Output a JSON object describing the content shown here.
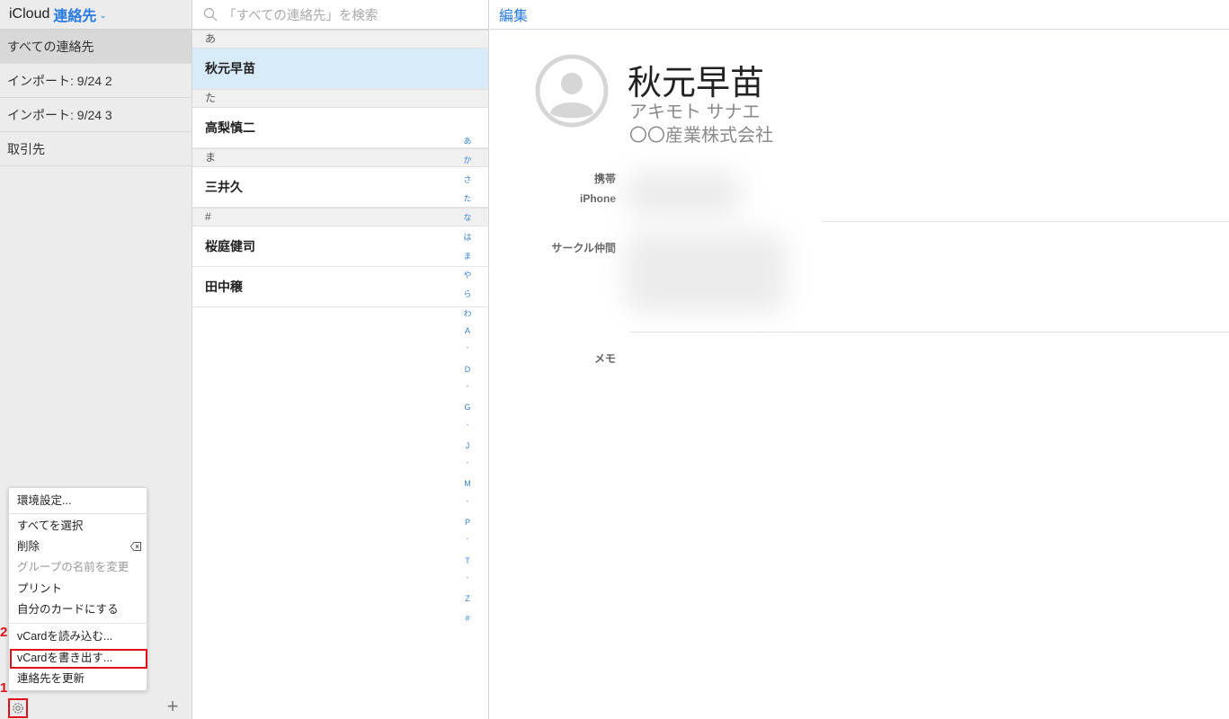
{
  "header": {
    "app_name": "iCloud",
    "section": "連絡先",
    "edit_label": "編集"
  },
  "sidebar": {
    "groups": [
      {
        "label": "すべての連絡先"
      },
      {
        "label": "インポート: 9/24 2"
      },
      {
        "label": "インポート: 9/24 3"
      },
      {
        "label": "取引先"
      }
    ],
    "add_symbol": "+"
  },
  "annotations": {
    "step1": "1",
    "step2": "2"
  },
  "menu": {
    "items": [
      {
        "label": "環境設定..."
      },
      {
        "label": "すべてを選択"
      },
      {
        "label": "削除"
      },
      {
        "label": "グループの名前を変更"
      },
      {
        "label": "プリント"
      },
      {
        "label": "自分のカードにする"
      },
      {
        "label": "vCardを読み込む..."
      },
      {
        "label": "vCardを書き出す..."
      },
      {
        "label": "連絡先を更新"
      }
    ]
  },
  "search": {
    "placeholder": "「すべての連絡先」を検索"
  },
  "contacts": {
    "sections": [
      {
        "header": "あ",
        "names": [
          "秋元早苗"
        ]
      },
      {
        "header": "た",
        "names": [
          "高梨慎二"
        ]
      },
      {
        "header": "ま",
        "names": [
          "三井久"
        ]
      },
      {
        "header": "#",
        "names": [
          "桜庭健司",
          "田中穣"
        ]
      }
    ],
    "index": [
      "あ",
      "か",
      "さ",
      "た",
      "な",
      "は",
      "ま",
      "や",
      "ら",
      "わ",
      "A",
      "•",
      "D",
      "•",
      "G",
      "•",
      "J",
      "•",
      "M",
      "•",
      "P",
      "•",
      "T",
      "•",
      "Z",
      "#"
    ]
  },
  "detail": {
    "name": "秋元早苗",
    "reading": "アキモト サナエ",
    "company": "〇〇産業株式会社",
    "phone_label": "携帯",
    "phone_sub_label": "iPhone",
    "group_label": "サークル仲間",
    "memo_label": "メモ"
  },
  "colors": {
    "accent": "#2a7be4",
    "highlight": "#e0101a",
    "selected_row": "#d7ebf8"
  }
}
